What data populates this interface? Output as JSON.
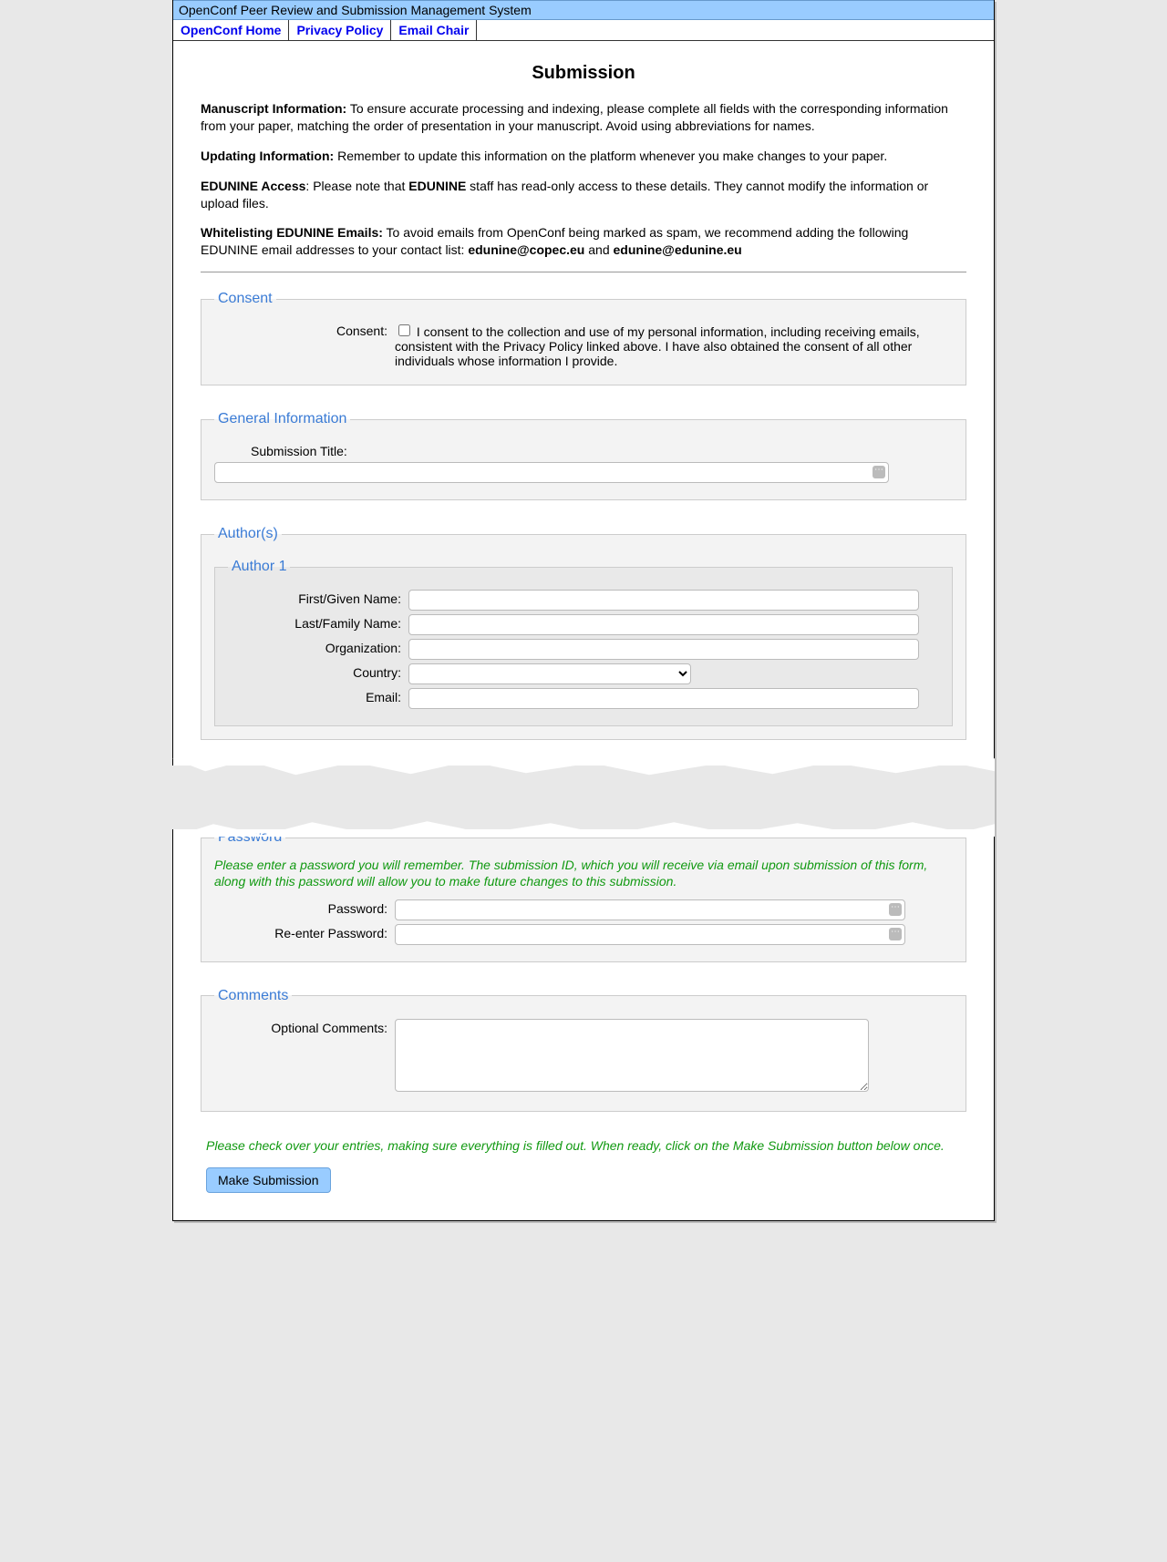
{
  "header": {
    "system_title": "OpenConf Peer Review and Submission Management System"
  },
  "nav": {
    "home": "OpenConf Home",
    "privacy": "Privacy Policy",
    "email": "Email Chair"
  },
  "page": {
    "title": "Submission"
  },
  "intro": {
    "p1_label": "Manuscript Information:",
    "p1_text": " To ensure accurate processing and indexing, please complete all fields with the corresponding information from your paper, matching the order of presentation in your manuscript.  Avoid using abbreviations for names.",
    "p2_label": "Updating Information:",
    "p2_text": " Remember to update this information on the platform whenever you make changes to your paper.",
    "p3_label": "EDUNINE Access",
    "p3_text_a": ": Please note that ",
    "p3_bold": "EDUNINE",
    "p3_text_b": " staff has read-only access to these details. They cannot modify the information or upload files.",
    "p4_label": "Whitelisting EDUNINE Emails:",
    "p4_text_a": " To avoid emails from OpenConf being marked as spam,  we recommend adding the following EDUNINE email addresses to your contact list: ",
    "p4_email1": "edunine@copec.eu",
    "p4_and": "   and   ",
    "p4_email2": "edunine@edunine.eu"
  },
  "consent": {
    "legend": "Consent",
    "label": "Consent:",
    "text": "I consent to the collection and use of my personal information, including receiving emails, consistent with the Privacy Policy linked above. I have also obtained the consent of all other individuals whose information I provide."
  },
  "general": {
    "legend": "General Information",
    "title_label": "Submission Title:"
  },
  "authors": {
    "legend": "Author(s)",
    "a1": {
      "legend": "Author 1",
      "first": "First/Given Name:",
      "last": "Last/Family Name:",
      "org": "Organization:",
      "country": "Country:",
      "email": "Email:"
    }
  },
  "password": {
    "legend": "Password",
    "hint": "Please enter a password you will remember. The submission ID, which you will receive via email upon submission of this form, along with this password will allow you to make future changes to this submission.",
    "pw": "Password:",
    "pw2": "Re-enter Password:"
  },
  "comments": {
    "legend": "Comments",
    "label": "Optional Comments:"
  },
  "final": {
    "hint": "Please check over your entries, making sure everything is filled out. When ready, click on the Make Submission button below once.",
    "button": "Make Submission"
  }
}
